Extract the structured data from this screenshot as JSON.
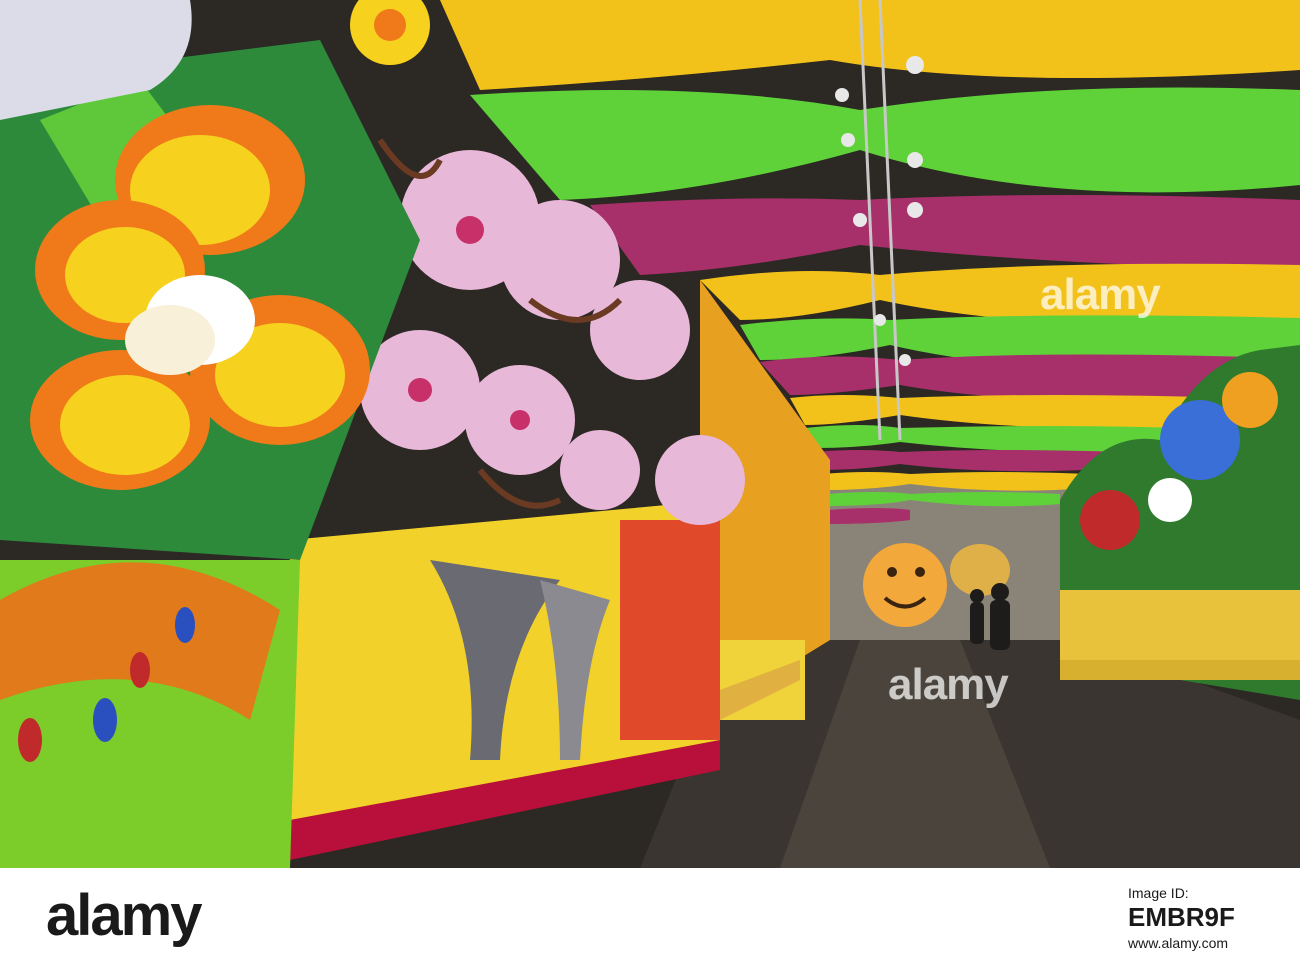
{
  "watermarks": [
    "alamy",
    "alamy"
  ],
  "footer": {
    "brand": "alamy",
    "image_id_label": "Image ID:",
    "image_id": "EMBR9F",
    "url": "www.alamy.com"
  },
  "colors": {
    "drape_yellow": "#f2c21a",
    "drape_green": "#5fd23a",
    "drape_magenta": "#a8306a",
    "floor": "#3a3530"
  }
}
